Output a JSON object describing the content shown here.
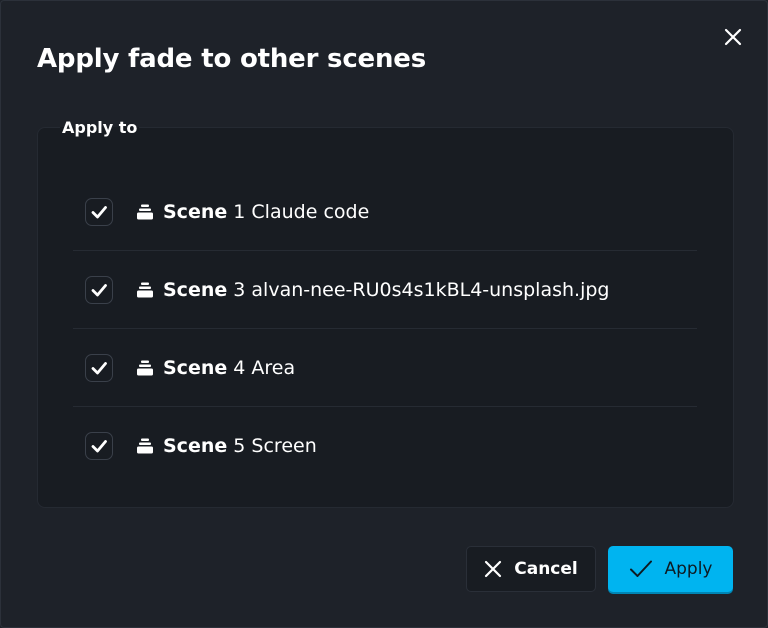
{
  "dialog": {
    "title": "Apply fade to other scenes",
    "close_icon": "close-icon"
  },
  "section": {
    "legend": "Apply to"
  },
  "scenes": [
    {
      "word": "Scene",
      "rest": " 1 Claude code",
      "checked": true,
      "icon": "stack-icon"
    },
    {
      "word": "Scene",
      "rest": " 3 alvan-nee-RU0s4s1kBL4-unsplash.jpg",
      "checked": true,
      "icon": "stack-icon"
    },
    {
      "word": "Scene",
      "rest": " 4 Area",
      "checked": true,
      "icon": "stack-icon"
    },
    {
      "word": "Scene",
      "rest": " 5 Screen",
      "checked": true,
      "icon": "stack-icon"
    }
  ],
  "buttons": {
    "cancel_label": "Cancel",
    "cancel_icon": "x-icon",
    "apply_label": "Apply",
    "apply_icon": "checkmark-icon"
  },
  "colors": {
    "background": "#1e2229",
    "panel": "#181c22",
    "accent": "#00b4f0",
    "text": "#ffffff"
  }
}
